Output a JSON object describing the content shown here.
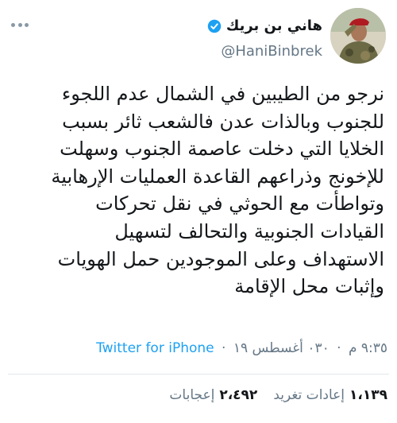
{
  "header": {
    "display_name": "هاني بن بريك",
    "handle": "@HaniBinbrek",
    "verified": true,
    "more_icon": "more-dots-icon"
  },
  "tweet": {
    "lines": [
      "نرجو من الطيبين في الشمال عدم اللجوء",
      "للجنوب وبالذات عدن فالشعب ثائر بسبب",
      "الخلايا التي دخلت عاصمة الجنوب وسهلت",
      "للإخونج وذراعهم القاعدة العمليات الإرهابية",
      "وتواطأت مع الحوثي في نقل تحركات",
      "القيادات الجنوبية والتحالف لتسهيل",
      "الاستهداف وعلى الموجودين حمل الهويات",
      "وإثبات محل الإقامة"
    ]
  },
  "meta": {
    "time": "٩:٣٥ م",
    "date": "٠٣٠ أغسطس ١٩",
    "separator": "·",
    "client": "Twitter for iPhone"
  },
  "stats": {
    "retweets_count": "١،١٣٩",
    "retweets_label": "إعادات تغريد",
    "likes_count": "٢،٤٩٢",
    "likes_label": "إعجابات"
  },
  "colors": {
    "link": "#1da1f2",
    "verified": "#1da1f2",
    "muted": "#657786",
    "text": "#14171a"
  }
}
